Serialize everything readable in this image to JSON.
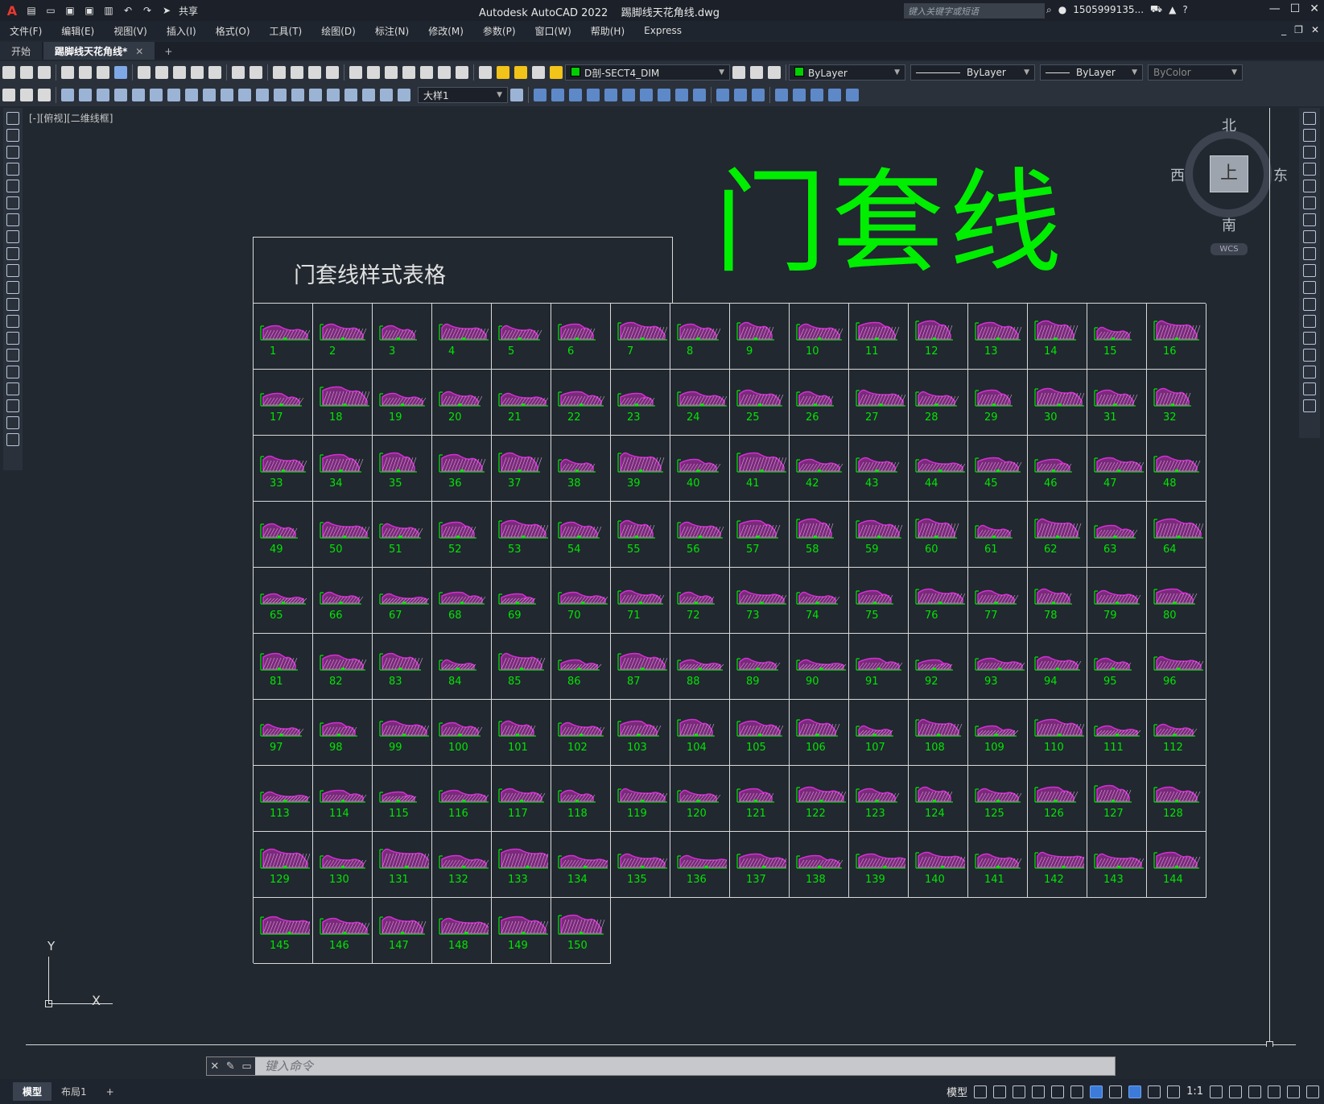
{
  "app": {
    "title": "Autodesk AutoCAD 2022",
    "file_name": "踢脚线天花角线.dwg",
    "share_label": "共享",
    "search_placeholder": "键入关键字或短语",
    "user": "1505999135...",
    "logo": "A"
  },
  "menu": [
    "文件(F)",
    "编辑(E)",
    "视图(V)",
    "插入(I)",
    "格式(O)",
    "工具(T)",
    "绘图(D)",
    "标注(N)",
    "修改(M)",
    "参数(P)",
    "窗口(W)",
    "帮助(H)",
    "Express"
  ],
  "tabs": [
    {
      "label": "开始",
      "active": false
    },
    {
      "label": "踢脚线天花角线*",
      "active": true
    }
  ],
  "toolbar": {
    "layer": "D剖-SECT4_DIM",
    "color": "ByLayer",
    "linetype": "ByLayer",
    "lineweight": "ByLayer",
    "plotstyle": "ByColor",
    "dimstyle": "大样1",
    "layer_color": "#00d000"
  },
  "viewport": {
    "label": "[-][俯视][二维线框]"
  },
  "drawing": {
    "big_title": "门套线",
    "table_title": "门套线样式表格",
    "items": [
      "1",
      "2",
      "3",
      "4",
      "5",
      "6",
      "7",
      "8",
      "9",
      "10",
      "11",
      "12",
      "13",
      "14",
      "15",
      "16",
      "17",
      "18",
      "19",
      "20",
      "21",
      "22",
      "23",
      "24",
      "25",
      "26",
      "27",
      "28",
      "29",
      "30",
      "31",
      "32",
      "33",
      "34",
      "35",
      "36",
      "37",
      "38",
      "39",
      "40",
      "41",
      "42",
      "43",
      "44",
      "45",
      "46",
      "47",
      "48",
      "49",
      "50",
      "51",
      "52",
      "53",
      "54",
      "55",
      "56",
      "57",
      "58",
      "59",
      "60",
      "61",
      "62",
      "63",
      "64",
      "65",
      "66",
      "67",
      "68",
      "69",
      "70",
      "71",
      "72",
      "73",
      "74",
      "75",
      "76",
      "77",
      "78",
      "79",
      "80",
      "81",
      "82",
      "83",
      "84",
      "85",
      "86",
      "87",
      "88",
      "89",
      "90",
      "91",
      "92",
      "93",
      "94",
      "95",
      "96",
      "97",
      "98",
      "99",
      "100",
      "101",
      "102",
      "103",
      "104",
      "105",
      "106",
      "107",
      "108",
      "109",
      "110",
      "111",
      "112",
      "113",
      "114",
      "115",
      "116",
      "117",
      "118",
      "119",
      "120",
      "121",
      "122",
      "123",
      "124",
      "125",
      "126",
      "127",
      "128",
      "129",
      "130",
      "131",
      "132",
      "133",
      "134",
      "135",
      "136",
      "137",
      "138",
      "139",
      "140",
      "141",
      "142",
      "143",
      "144",
      "145",
      "146",
      "147",
      "148",
      "149",
      "150"
    ],
    "profile_color": "#d62ed6",
    "label_color": "#00e600",
    "title_color": "#00ee00"
  },
  "viewcube": {
    "north": "北",
    "south": "南",
    "east": "东",
    "west": "西",
    "top_face": "上",
    "wcs": "WCS"
  },
  "ucs": {
    "y": "Y",
    "x": "X"
  },
  "command": {
    "placeholder": "键入命令"
  },
  "status": {
    "layout_tabs": [
      {
        "label": "模型",
        "active": true
      },
      {
        "label": "布局1",
        "active": false
      }
    ],
    "model_label": "模型",
    "scale": "1:1"
  }
}
